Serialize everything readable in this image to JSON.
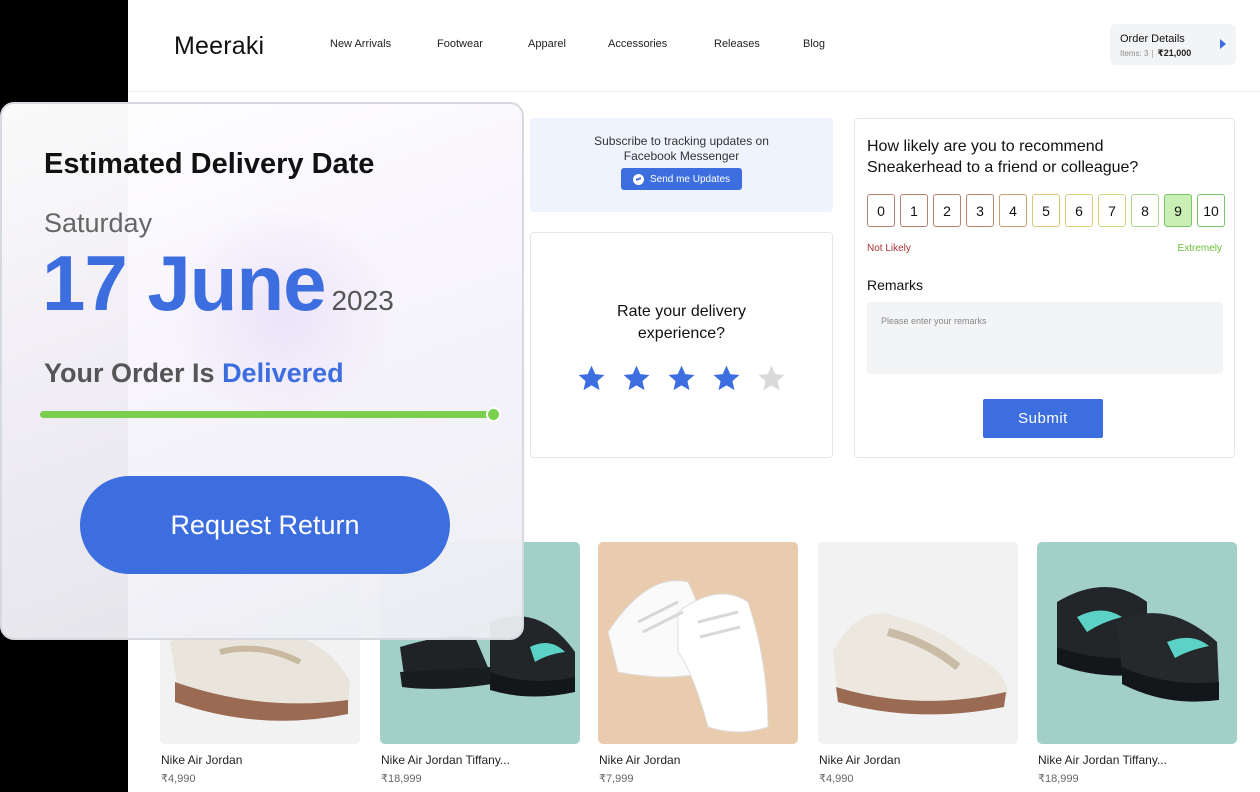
{
  "header": {
    "logo": "Meeraki",
    "nav": [
      "New Arrivals",
      "Footwear",
      "Apparel",
      "Accessories",
      "Releases",
      "Blog"
    ],
    "order": {
      "title": "Order Details",
      "items": "Items: 3",
      "amount": "₹21,000"
    }
  },
  "subscribe": {
    "text": "Subscribe to tracking updates on Facebook Messenger",
    "button": "Send me Updates"
  },
  "rating": {
    "title": "Rate your delivery experience?",
    "max": 5,
    "value": 4,
    "colors": {
      "filled": "#3d6ee0",
      "empty": "#d9d9d9"
    }
  },
  "nps": {
    "question": "How likely are you to recommend Sneakerhead to a friend or colleague?",
    "scale": [
      "0",
      "1",
      "2",
      "3",
      "4",
      "5",
      "6",
      "7",
      "8",
      "9",
      "10"
    ],
    "selected": "9",
    "low_label": "Not Likely",
    "high_label": "Extremely",
    "remarks_label": "Remarks",
    "remarks_placeholder": "Please enter your remarks",
    "submit": "Submit"
  },
  "products": [
    {
      "name": "Nike Air Jordan",
      "price": "₹4,990"
    },
    {
      "name": "Nike Air Jordan Tiffany...",
      "price": "₹18,999"
    },
    {
      "name": "Nike Air Jordan",
      "price": "₹7,999"
    },
    {
      "name": "Nike Air Jordan",
      "price": "₹4,990"
    },
    {
      "name": "Nike Air Jordan Tiffany...",
      "price": "₹18,999"
    }
  ],
  "delivery": {
    "title": "Estimated Delivery Date",
    "day": "Saturday",
    "date": "17 June",
    "year": "2023",
    "status_prefix": "Your Order Is",
    "status": "Delivered",
    "progress": 1.0,
    "button": "Request Return",
    "colors": {
      "accent": "#3d6ee0",
      "progress": "#7ad04e"
    }
  }
}
